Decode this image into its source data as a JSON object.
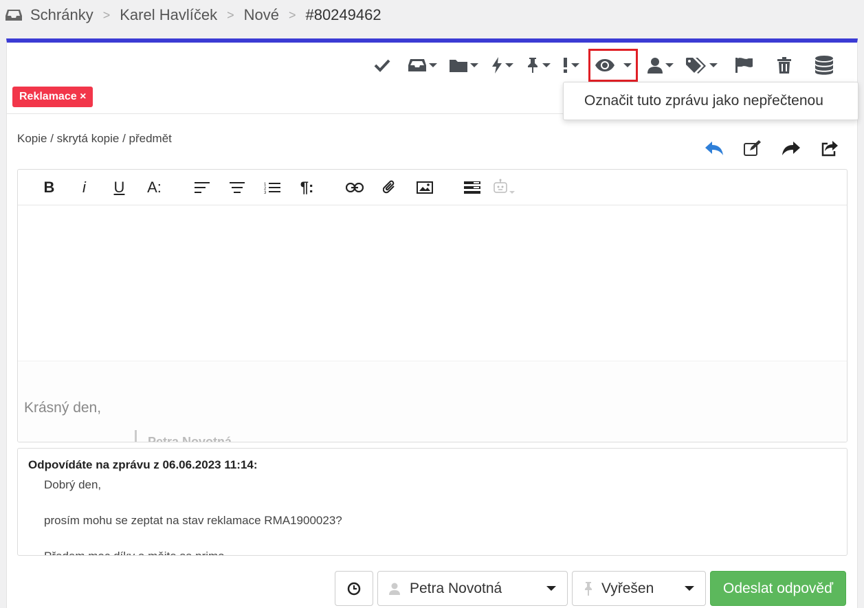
{
  "breadcrumb": {
    "items": [
      "Schránky",
      "Karel Havlíček",
      "Nové",
      "#80249462"
    ],
    "separator": ">"
  },
  "toolbar": {
    "icons": [
      "check-icon",
      "inbox-icon",
      "folder-icon",
      "bolt-icon",
      "pin-icon",
      "exclamation-icon",
      "eye-icon",
      "user-icon",
      "tags-icon",
      "flag-icon",
      "trash-icon",
      "database-icon"
    ]
  },
  "dropdown": {
    "mark_unread_label": "Označit tuto zprávu jako nepřečtenou"
  },
  "tag": {
    "label": "Reklamace ×",
    "color": "#f2364a"
  },
  "compose": {
    "cc_link": "Kopie / skrytá kopie / předmět"
  },
  "editor": {
    "bold": "B",
    "italic": "i",
    "underline": "U",
    "font_size": "A:",
    "paragraph": "¶:",
    "signature_greeting": "Krásný den,",
    "signature_name": "Petra Novotná"
  },
  "quote": {
    "heading": "Odpovídáte na zprávu z 06.06.2023 11:14:",
    "lines": [
      "Dobrý den,",
      "prosím mohu se zeptat na stav reklamace RMA1900023?",
      "Předem moc díky a mějte se prima"
    ]
  },
  "footer": {
    "assignee": "Petra Novotná",
    "status": "Vyřešen",
    "send_label": "Odeslat odpověď",
    "send_color": "#5cb85c"
  },
  "accent_color": "#3b3bd4"
}
